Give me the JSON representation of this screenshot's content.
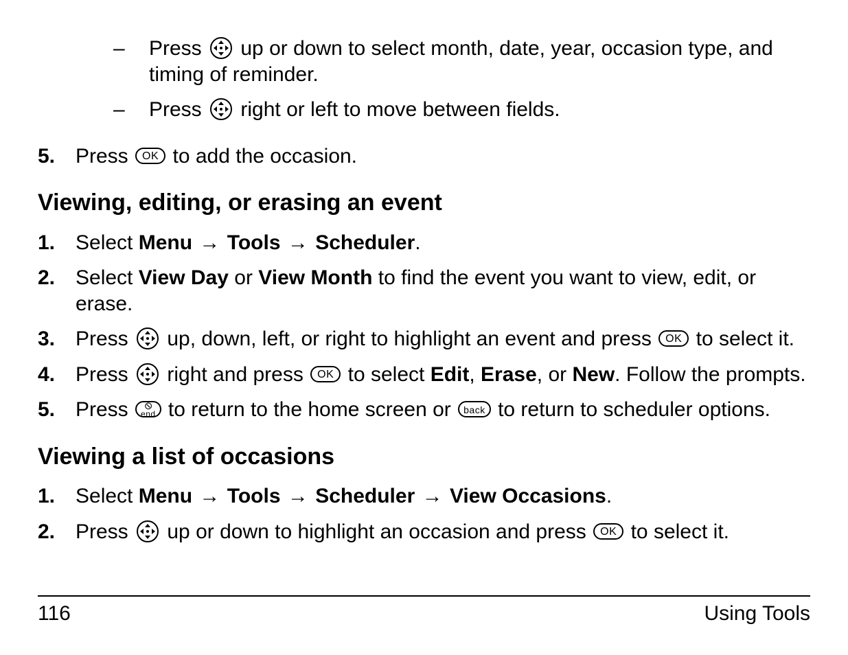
{
  "intro_sublist": [
    {
      "pre": "Press ",
      "icon": "nav",
      "post": " up or down to select month, date, year, occasion type, and timing of reminder."
    },
    {
      "pre": "Press ",
      "icon": "nav",
      "post": " right or left to move between fields."
    }
  ],
  "intro_step5": {
    "num": "5.",
    "pre": "Press ",
    "icon": "ok",
    "ok_label": "OK",
    "post": " to add the occasion."
  },
  "section1": {
    "heading": "Viewing, editing, or erasing an event",
    "step1": {
      "num": "1.",
      "pre": "Select ",
      "path": [
        "Menu",
        "Tools",
        "Scheduler"
      ],
      "arrow": "→",
      "post": "."
    },
    "step2": {
      "num": "2.",
      "pre": "Select ",
      "opt1": "View Day",
      "mid": " or ",
      "opt2": "View Month",
      "post": " to find the event you want to view, edit, or erase."
    },
    "step3": {
      "num": "3.",
      "pre": "Press ",
      "icon1": "nav",
      "mid": " up, down, left, or right to highlight an event and press ",
      "icon2": "ok",
      "ok_label": "OK",
      "post": " to select it."
    },
    "step4": {
      "num": "4.",
      "pre": "Press ",
      "icon1": "nav",
      "mid1": " right and press ",
      "icon2": "ok",
      "ok_label": "OK",
      "mid2": " to select ",
      "opts": [
        "Edit",
        "Erase",
        "New"
      ],
      "sep1": ", ",
      "sep2": ", or ",
      "post": ". Follow the prompts."
    },
    "step5": {
      "num": "5.",
      "pre": "Press ",
      "icon1": "end",
      "end_label": "end",
      "mid": " to return to the home screen or ",
      "icon2": "back",
      "back_label": "back",
      "post": " to return to scheduler options."
    }
  },
  "section2": {
    "heading": "Viewing a list of occasions",
    "step1": {
      "num": "1.",
      "pre": "Select ",
      "path": [
        "Menu",
        "Tools",
        "Scheduler",
        "View Occasions"
      ],
      "arrow": "→",
      "post": "."
    },
    "step2": {
      "num": "2.",
      "pre": "Press ",
      "icon1": "nav",
      "mid": " up or down to highlight an occasion and press ",
      "icon2": "ok",
      "ok_label": "OK",
      "post": " to select it."
    }
  },
  "footer": {
    "page_num": "116",
    "section": "Using Tools"
  },
  "icon_labels": {
    "ok": "OK",
    "back": "back",
    "end": "end"
  },
  "dash": "–"
}
